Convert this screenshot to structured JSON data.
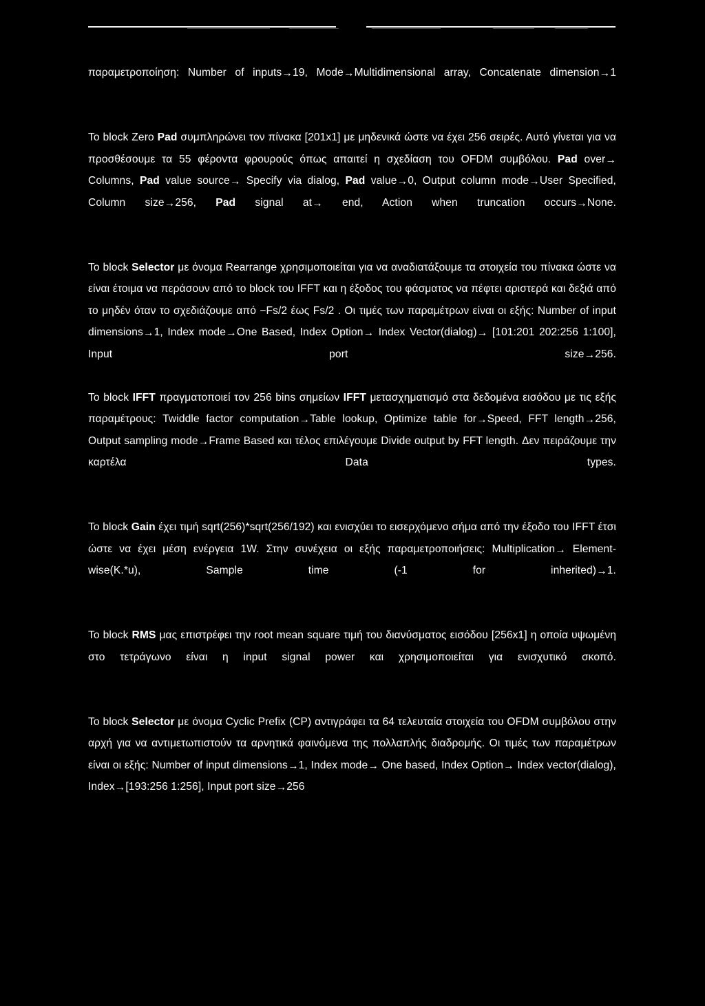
{
  "page": {
    "background_color": "#000000",
    "text_color": "#ffffff",
    "language": "el",
    "document_type": "scanned-inverted-thesis-page"
  },
  "header": {
    "rule_left": "",
    "rule_right": ""
  },
  "paragraphs": [
    {
      "id": "concatenate-params",
      "text": "παραμετροποίηση: Number of inputs→19, Mode→Multidimensional array, Concatenate dimension→1"
    },
    {
      "id": "zero-pad",
      "text": "Το block Zero Pad συμπληρώνει τον πίνακα [201x1] με μηδενικά ώστε να έχει 256 σειρές. Αυτό γίνεται για να προσθέσουμε τα 55 φέροντα φρουρούς όπως απαιτεί η σχεδίαση του OFDM συμβόλου. Pad over→ Columns, Pad value source→ Specify via dialog, Pad value→0, Output column mode→User Specified, Column size→256, Pad signal at→ end, Action when truncation occurs→None.",
      "bold_terms": [
        "Pad"
      ]
    },
    {
      "id": "selector-rearrange",
      "text": "Το block Selector με όνομα Rearrange χρησιμοποιείται για να αναδιατάξουμε τα στοιχεία του πίνακα ώστε να είναι έτοιμα να περάσουν από το block του IFFT και η έξοδος του φάσματος να πέφτει αριστερά και δεξιά από το μηδέν όταν το σχεδιάζουμε από −Fs/2 έως Fs/2 . Οι τιμές των παραμέτρων είναι οι εξής: Number of input dimensions→1, Index mode→One Based, Index Option→ Index Vector(dialog)→ [101:201 202:256 1:100], Input port size→256.",
      "bold_terms": [
        "Selector"
      ]
    },
    {
      "id": "ifft",
      "text": "Το block IFFT πραγματοποιεί τον 256 bins σημείων IFFT μετασχηματισμό στα δεδομένα εισόδου με τις εξής παραμέτρους: Twiddle factor computation→Table lookup, Optimize table for→Speed, FFT length→256, Output sampling mode→Frame Based και τέλος επιλέγουμε Divide output by FFT length. Δεν πειράζουμε την καρτέλα Data types.",
      "bold_terms": [
        "IFFT"
      ]
    },
    {
      "id": "gain",
      "text": "Το block Gain έχει τιμή sqrt(256)*sqrt(256/192) και ενισχύει το εισερχόμενο σήμα από την έξοδο του IFFT έτσι ώστε να έχει μέση ενέργεια 1W. Στην συνέχεια οι εξής παραμετροποιήσεις: Multiplication→ Element-wise(K.*u), Sample time (-1 for inherited)→1.",
      "bold_terms": [
        "Gain"
      ]
    },
    {
      "id": "rms",
      "text": "Το block RMS μας επιστρέφει την root mean square τιμή του διανύσματος εισόδου [256x1] η οποία υψωμένη στο τετράγωνο είναι η input signal power και χρησιμοποιείται για ενισχυτικό σκοπό.",
      "bold_terms": [
        "RMS"
      ]
    },
    {
      "id": "selector-cyclic-prefix",
      "text": "Το block Selector με όνομα Cyclic Prefix (CP) αντιγράφει τα 64 τελευταία στοιχεία του OFDM συμβόλου στην αρχή για να αντιμετωπιστούν τα αρνητικά φαινόμενα της πολλαπλής διαδρομής. Οι τιμές των παραμέτρων είναι οι εξής: Number of input dimensions→1, Index mode→ One based, Index Option→ Index vector(dialog), Index→[193:256 1:256], Input port size→256",
      "bold_terms": [
        "Selector"
      ]
    }
  ],
  "segments": {
    "p1": [
      {
        "t": "παραμετροποίηση: Number of inputs",
        "b": false
      },
      {
        "t": "→",
        "b": false,
        "arrow": true
      },
      {
        "t": "19, Mode",
        "b": false
      },
      {
        "t": "→",
        "b": false,
        "arrow": true
      },
      {
        "t": "Multidimensional array, Concatenate dimension",
        "b": false
      },
      {
        "t": "→",
        "b": false,
        "arrow": true
      },
      {
        "t": "1",
        "b": false
      }
    ]
  },
  "parameters": {
    "concatenate": {
      "number_of_inputs": "19",
      "mode": "Multidimensional array",
      "concatenate_dimension": "1"
    },
    "zero_pad": {
      "input_matrix": "[201x1]",
      "target_rows": "256",
      "guard_carriers": "55",
      "pad_over": "Columns",
      "pad_value_source": "Specify via dialog",
      "pad_value": "0",
      "output_column_mode": "User Specified",
      "column_size": "256",
      "pad_signal_at": "end",
      "action_when_truncation_occurs": "None"
    },
    "selector_rearrange": {
      "name": "Rearrange",
      "number_of_input_dimensions": "1",
      "index_mode": "One Based",
      "index_option": "Index Vector(dialog)",
      "index_vector": "[101:201 202:256 1:100]",
      "input_port_size": "256",
      "plot_range": "−Fs/2 έως Fs/2"
    },
    "ifft": {
      "bins": "256",
      "twiddle_factor_computation": "Table lookup",
      "optimize_table_for": "Speed",
      "fft_length": "256",
      "output_sampling_mode": "Frame Based",
      "divide_output_by_fft_length": "true",
      "data_types_tab": "unchanged"
    },
    "gain": {
      "value": "sqrt(256)*sqrt(256/192)",
      "average_energy": "1W",
      "multiplication": "Element-wise(K.*u)",
      "sample_time": "1"
    },
    "rms": {
      "input_vector": "[256x1]",
      "purpose": "input signal power"
    },
    "selector_cyclic_prefix": {
      "name": "Cyclic Prefix (CP)",
      "copied_samples": "64",
      "number_of_input_dimensions": "1",
      "index_mode": "One based",
      "index_option": "Index vector(dialog)",
      "index": "[193:256 1:256]",
      "input_port_size": "256"
    }
  }
}
